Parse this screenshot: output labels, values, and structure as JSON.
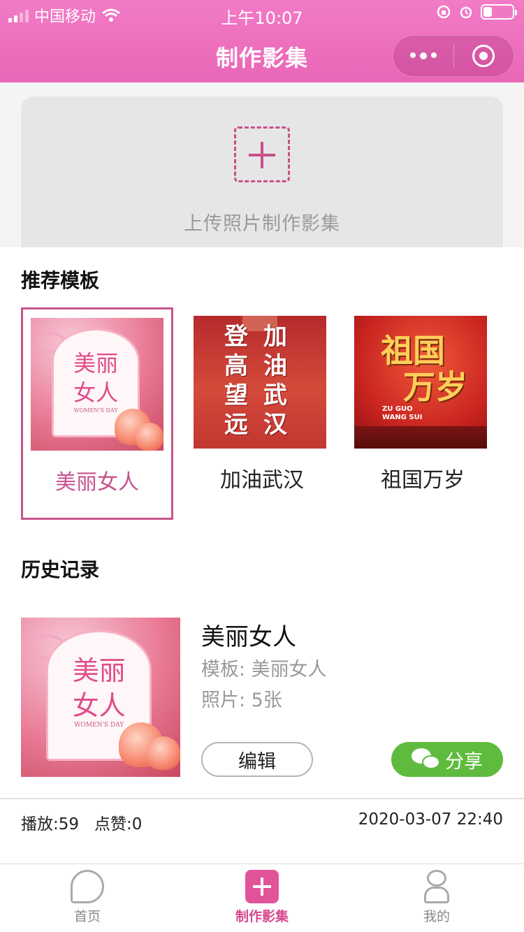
{
  "status_bar": {
    "carrier": "中国移动",
    "time": "上午10:07"
  },
  "navbar": {
    "title": "制作影集"
  },
  "upload": {
    "text": "上传照片制作影集"
  },
  "templates": {
    "title": "推荐模板",
    "items": [
      {
        "name": "美丽女人",
        "selected": true
      },
      {
        "name": "加油武汉",
        "selected": false
      },
      {
        "name": "祖国万岁",
        "selected": false
      }
    ],
    "art": {
      "pink_line1": "美丽",
      "pink_line2": "女人",
      "pink_en": "WOMEN'S DAY",
      "wuhan_col1": [
        "登",
        "高",
        "望",
        "远"
      ],
      "wuhan_col2": [
        "加",
        "油",
        "武",
        "汉"
      ],
      "china_cal1": "祖国",
      "china_cal2": "万岁",
      "china_en1": "ZU GUO",
      "china_en2": "WANG SUI"
    }
  },
  "history": {
    "title": "历史记录",
    "item": {
      "name": "美丽女人",
      "template_line": "模板: 美丽女人",
      "photos_line": "照片: 5张",
      "edit_label": "编辑",
      "share_label": "分享",
      "plays": "播放:59",
      "likes": "点赞:0",
      "date": "2020-03-07 22:40"
    }
  },
  "tabbar": {
    "items": [
      {
        "label": "首页",
        "icon": "home-icon",
        "active": false
      },
      {
        "label": "制作影集",
        "icon": "add-icon",
        "active": true
      },
      {
        "label": "我的",
        "icon": "profile-icon",
        "active": false
      }
    ]
  },
  "colors": {
    "header": "#ec6fbd",
    "accent": "#c6538e",
    "share": "#5fbb3e"
  }
}
